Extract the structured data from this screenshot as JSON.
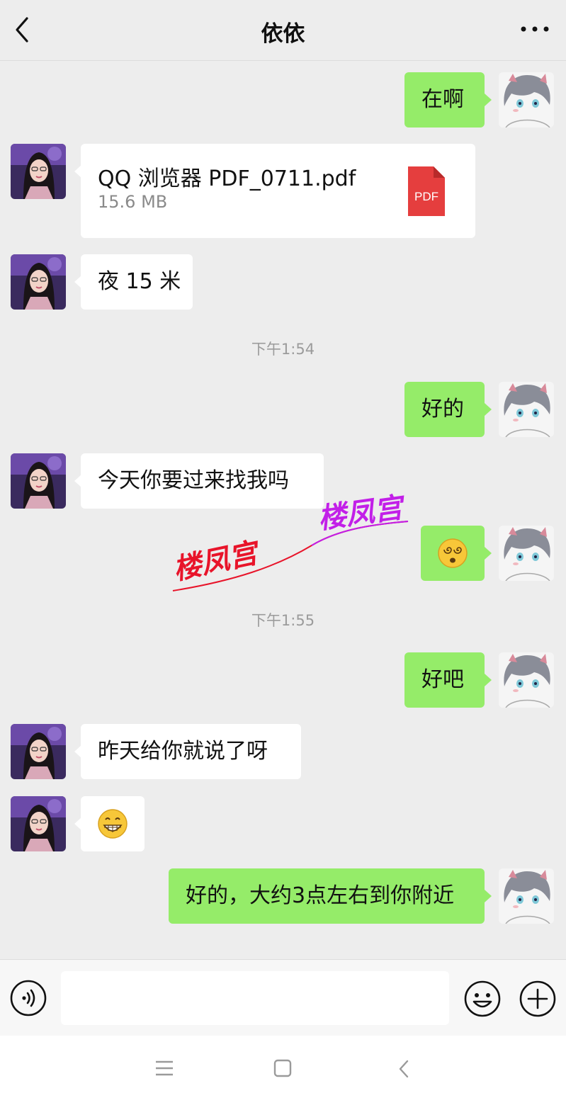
{
  "header": {
    "title": "依依"
  },
  "messages": {
    "m1": "在啊",
    "file": {
      "name": "QQ 浏览器 PDF_0711.pdf",
      "size": "15.6 MB",
      "icon_label": "PDF"
    },
    "m3": "夜 15 米",
    "time1": "下午1:54",
    "m4": "好的",
    "m5": "今天你要过来找我吗",
    "time2": "下午1:55",
    "m7": "好吧",
    "m8": "昨天给你就说了呀",
    "m10": "好的，大约3点左右到你附近"
  },
  "watermark": {
    "text1": "楼凤宫",
    "text2": "楼凤宫"
  },
  "icons": {
    "back": "chevron-left-icon",
    "more": "more-dots-icon",
    "voice": "voice-icon",
    "emoji": "smiley-icon",
    "plus": "plus-icon",
    "emoji_dizzy": "dizzy-face-emoji",
    "emoji_grin": "grinning-face-emoji"
  },
  "colors": {
    "out_bubble": "#95ec69",
    "in_bubble": "#ffffff",
    "background": "#ededed",
    "pdf": "#e53e3e"
  }
}
